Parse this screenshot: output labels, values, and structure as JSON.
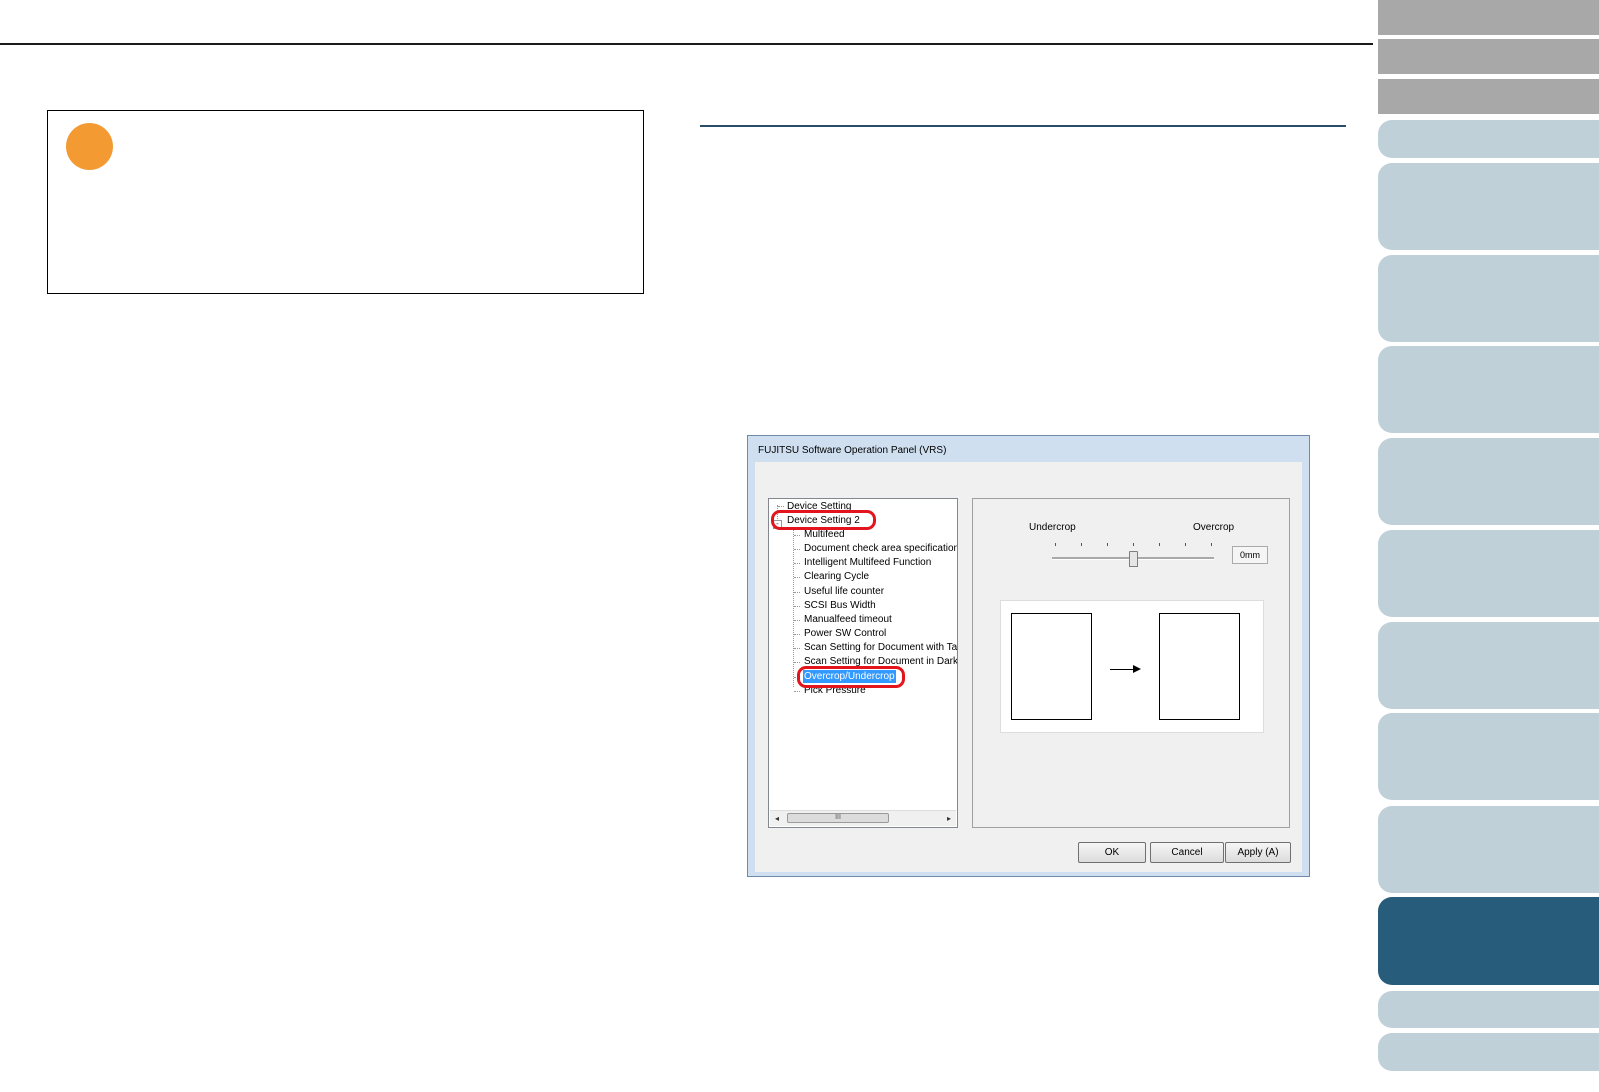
{
  "dialog": {
    "title": "FUJITSU Software Operation Panel (VRS)",
    "tree": {
      "root_items": [
        "Device Setting",
        "Device Setting 2"
      ],
      "children": [
        "Multifeed",
        "Document check area specification",
        "Intelligent Multifeed Function",
        "Clearing Cycle",
        "Useful life counter",
        "SCSI Bus Width",
        "Manualfeed timeout",
        "Power SW Control",
        "Scan Setting for Document with Tab",
        "Scan Setting for Document in Dark B",
        "Overcrop/Undercrop",
        "Pick Pressure"
      ],
      "selected": "Overcrop/Undercrop",
      "scroll_thumb_glyph": "III"
    },
    "settings": {
      "label_left": "Undercrop",
      "label_right": "Overcrop",
      "value": "0mm",
      "slider_position": 0.5
    },
    "buttons": {
      "ok": "OK",
      "cancel": "Cancel",
      "apply": "Apply (A)"
    }
  },
  "colors": {
    "caution_icon": "#f39a33",
    "highlight_oval": "#e3141b",
    "active_tab": "#285c7b",
    "inactive_tab": "#bfd0d9",
    "gray_tab": "#a8a8a8"
  }
}
